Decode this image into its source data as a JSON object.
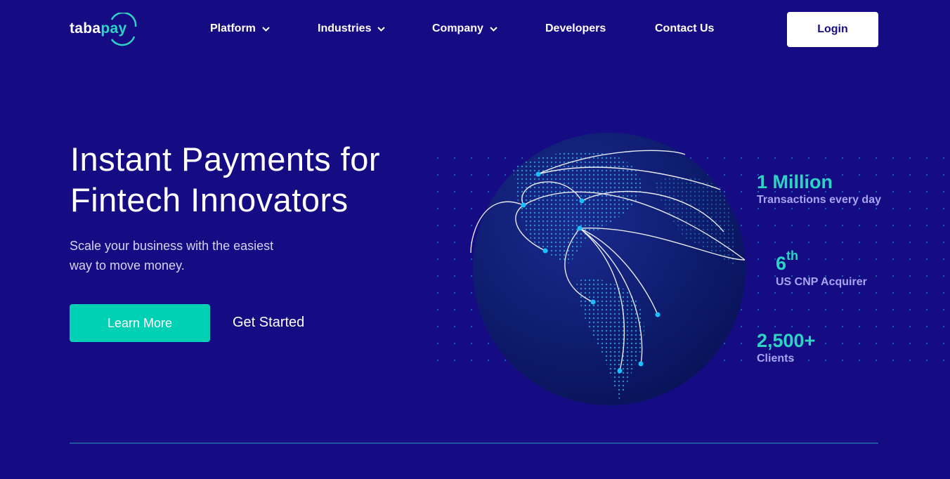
{
  "brand": {
    "logo_main": "taba",
    "logo_accent": "pay"
  },
  "nav": {
    "platform": "Platform",
    "industries": "Industries",
    "company": "Company",
    "developers": "Developers",
    "contact": "Contact Us",
    "login": "Login"
  },
  "hero": {
    "title_line1": "Instant Payments for",
    "title_line2": "Fintech Innovators",
    "subtitle_line1": "Scale your business with the easiest",
    "subtitle_line2": "way to move money.",
    "learn_more": "Learn More",
    "get_started": "Get Started"
  },
  "stats": [
    {
      "value": "1 Million",
      "label": "Transactions every day"
    },
    {
      "value": "6",
      "suffix": "th",
      "label": "US CNP Acquirer"
    },
    {
      "value": "2,500+",
      "label": "Clients"
    }
  ],
  "colors": {
    "background": "#150c84",
    "accent": "#00d0b4",
    "stat_value": "#2fd3c4",
    "stat_label": "#a9a4f2",
    "button_text": "#150c84"
  },
  "icons": {
    "dropdown": "chevron-down-icon",
    "globe": "globe-illustration"
  }
}
